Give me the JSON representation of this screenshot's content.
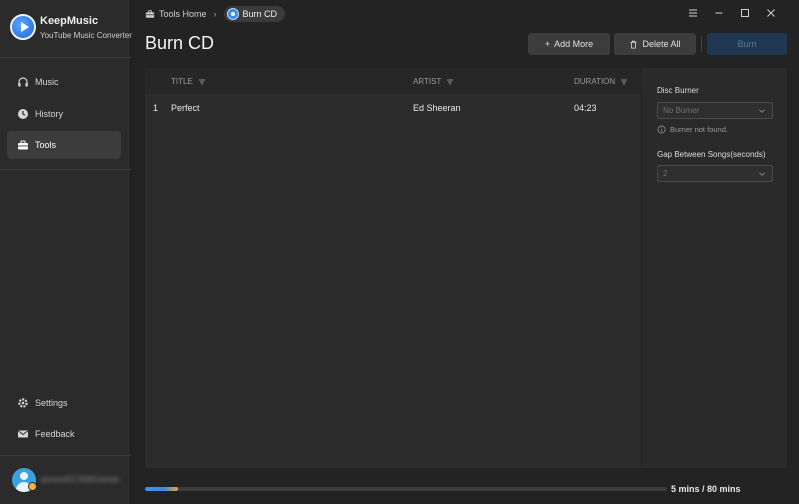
{
  "brand": {
    "name": "KeepMusic",
    "subtitle": "YouTube Music Converter"
  },
  "sidebar": {
    "items": [
      {
        "label": "Music",
        "icon": "headphones-icon"
      },
      {
        "label": "History",
        "icon": "clock-icon"
      },
      {
        "label": "Tools",
        "icon": "toolbox-icon",
        "active": true
      }
    ],
    "bottom_items": [
      {
        "label": "Settings",
        "icon": "gear-icon"
      },
      {
        "label": "Feedback",
        "icon": "mail-icon"
      }
    ],
    "user_email": "jamesd0178@hotmail.com"
  },
  "breadcrumb": {
    "home": "Tools Home",
    "current": "Burn CD"
  },
  "page": {
    "title": "Burn CD"
  },
  "toolbar": {
    "add_label": "Add More",
    "delete_label": "Delete All",
    "burn_label": "Burn"
  },
  "table": {
    "columns": [
      "TITLE",
      "ARTIST",
      "DURATION"
    ],
    "rows": [
      {
        "index": "1",
        "title": "Perfect",
        "artist": "Ed Sheeran",
        "duration": "04:23"
      }
    ]
  },
  "settings": {
    "disc_burner_label": "Disc Burner",
    "disc_burner_value": "No Burner",
    "burner_hint": "Burner not found.",
    "gap_label": "Gap Between Songs(seconds)",
    "gap_value": "2"
  },
  "status": {
    "capacity_text": "5 mins / 80 mins",
    "used_fraction": 0.0625
  },
  "colors": {
    "accent": "#3d8ee6",
    "burn_disabled_bg": "#1f3752",
    "progress_end": "#e8a13a"
  }
}
